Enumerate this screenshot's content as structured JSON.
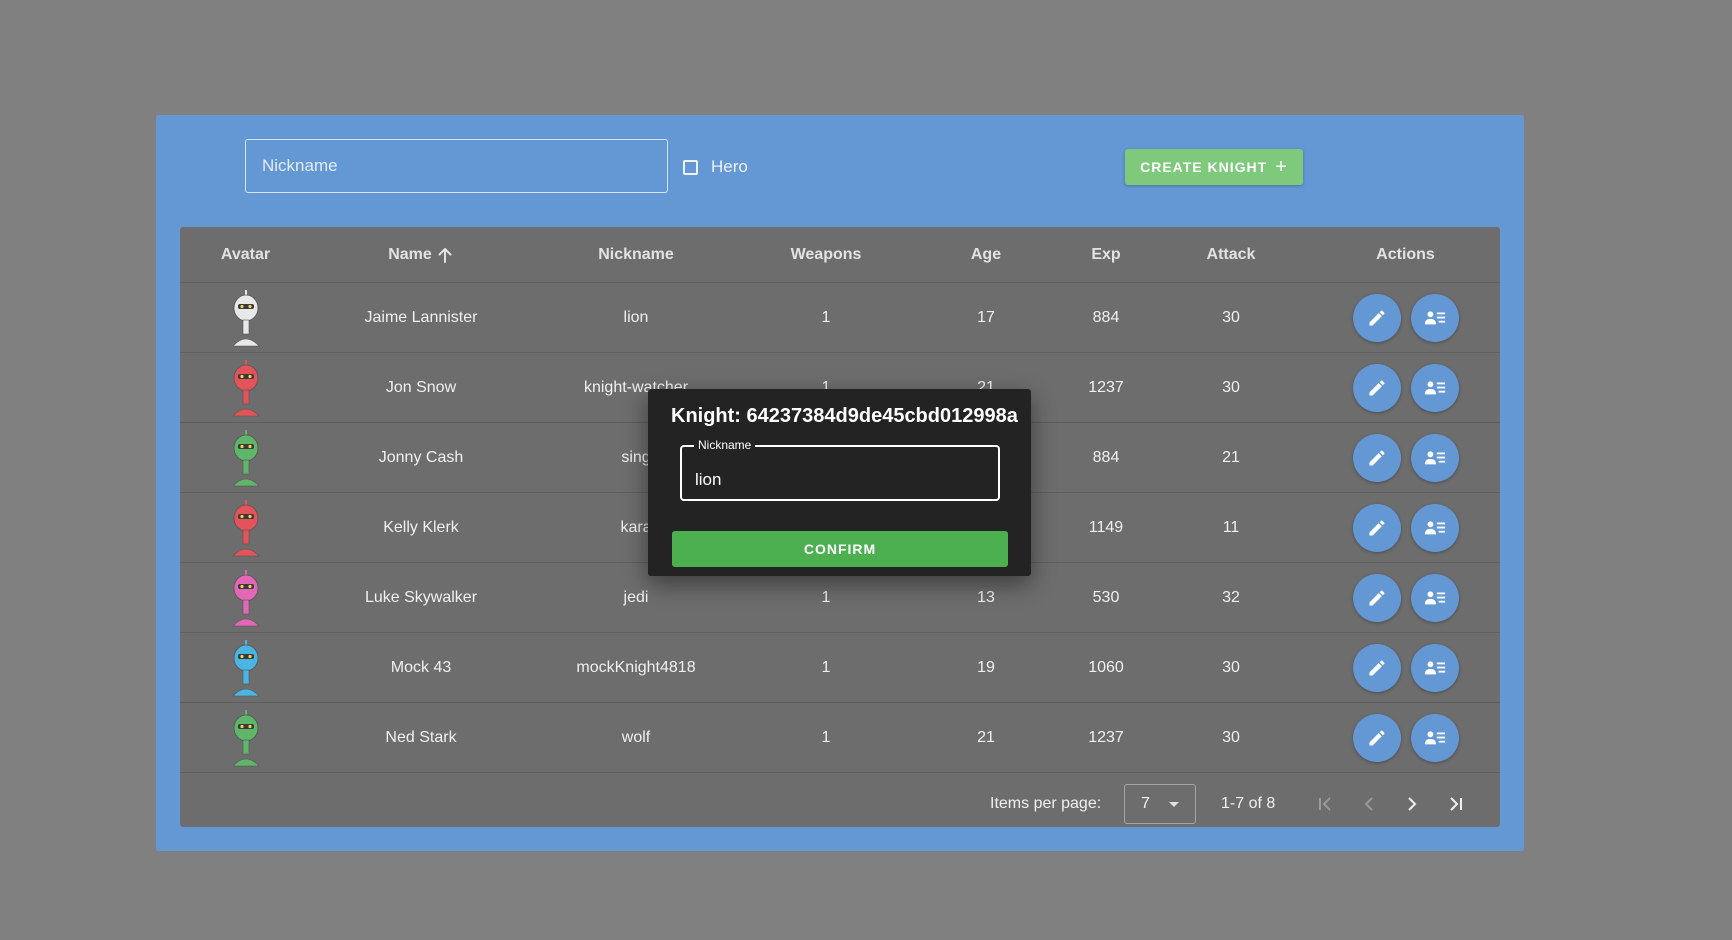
{
  "toolbar": {
    "nickname_placeholder": "Nickname",
    "hero_label": "Hero",
    "create_label": "CREATE KNIGHT",
    "create_icon": "+"
  },
  "table": {
    "headers": {
      "avatar": "Avatar",
      "name": "Name",
      "nickname": "Nickname",
      "weapons": "Weapons",
      "age": "Age",
      "exp": "Exp",
      "attack": "Attack",
      "actions": "Actions"
    },
    "sort": {
      "column": "name",
      "direction": "ascending",
      "icon": "arrow-up-icon"
    },
    "rows": [
      {
        "name": "Jaime Lannister",
        "nickname": "lion",
        "weapons": "1",
        "age": "17",
        "exp": "884",
        "attack": "30",
        "avatar_color": "#e8e8e8"
      },
      {
        "name": "Jon Snow",
        "nickname": "knight-watcher",
        "weapons": "1",
        "age": "21",
        "exp": "1237",
        "attack": "30",
        "avatar_color": "#e2545a"
      },
      {
        "name": "Jonny Cash",
        "nickname": "sing",
        "weapons": "",
        "age": "",
        "exp": "884",
        "attack": "21",
        "avatar_color": "#5fb56a"
      },
      {
        "name": "Kelly Klerk",
        "nickname": "kara",
        "weapons": "",
        "age": "",
        "exp": "1149",
        "attack": "11",
        "avatar_color": "#e2545a"
      },
      {
        "name": "Luke Skywalker",
        "nickname": "jedi",
        "weapons": "1",
        "age": "13",
        "exp": "530",
        "attack": "32",
        "avatar_color": "#e267b6"
      },
      {
        "name": "Mock 43",
        "nickname": "mockKnight4818",
        "weapons": "1",
        "age": "19",
        "exp": "1060",
        "attack": "30",
        "avatar_color": "#4ab5e0"
      },
      {
        "name": "Ned Stark",
        "nickname": "wolf",
        "weapons": "1",
        "age": "21",
        "exp": "1237",
        "attack": "30",
        "avatar_color": "#5fb56a"
      }
    ]
  },
  "pagination": {
    "items_label": "Items per page:",
    "items_per_page": "7",
    "range": "1-7 of 8"
  },
  "dialog": {
    "title": "Knight: 64237384d9de45cbd012998a",
    "field_label": "Nickname",
    "field_value": "lion",
    "confirm_label": "CONFIRM"
  },
  "colors": {
    "page_bg": "#808080",
    "frame": "#6498d4",
    "table_bg": "#6d6d6d",
    "create_button": "#7fc97d",
    "action_button": "#6498d4",
    "dialog_bg": "#232323",
    "confirm_button": "#4caf50"
  }
}
